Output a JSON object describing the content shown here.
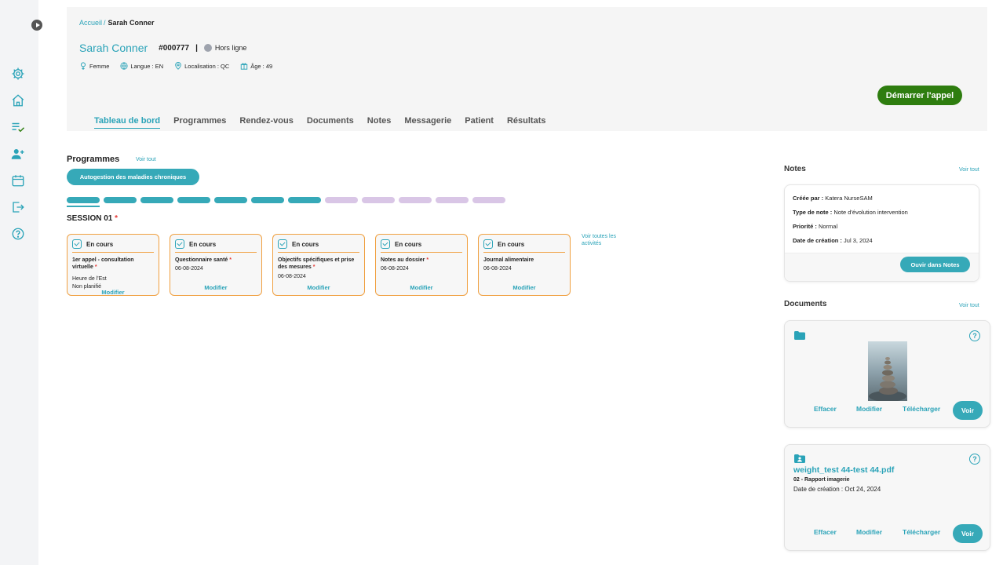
{
  "sidebar": {
    "items": [
      {
        "icon": "gear-icon"
      },
      {
        "icon": "home-icon"
      },
      {
        "icon": "checklist-icon"
      },
      {
        "icon": "add-user-icon"
      },
      {
        "icon": "calendar-icon"
      },
      {
        "icon": "logout-icon"
      },
      {
        "icon": "help-icon"
      }
    ],
    "accent": "#2aa3b8"
  },
  "header": {
    "breadcrumb": {
      "home": "Accueil",
      "separator": "/",
      "current": "Sarah Conner"
    },
    "patient": {
      "name": "Sarah Conner",
      "id": "#000777",
      "divider": "|",
      "status": "Hors ligne"
    },
    "meta": {
      "gender": "Femme",
      "language": "Langue : EN",
      "location": "Localisation : QC",
      "age": "Âge : 49"
    },
    "call_button": "Démarrer l'appel",
    "tabs": [
      "Tableau de bord",
      "Programmes",
      "Rendez-vous",
      "Documents",
      "Notes",
      "Messagerie",
      "Patient",
      "Résultats"
    ]
  },
  "programmes": {
    "title": "Programmes",
    "see_all": "Voir tout",
    "pill": "Autogestion des maladies chroniques",
    "segments": {
      "done": 7,
      "total": 12
    },
    "session": {
      "label": "SESSION 01",
      "required": "*"
    },
    "cards": [
      {
        "status": "En cours",
        "title": "1er appel - consultation virtuelle",
        "required": "*",
        "lines": [
          "Heure de l'Est",
          "Non planifié"
        ],
        "action": "Modifier"
      },
      {
        "status": "En cours",
        "title": "Questionnaire santé",
        "required": "*",
        "lines": [
          "06-08-2024"
        ],
        "action": "Modifier"
      },
      {
        "status": "En cours",
        "title": "Objectifs spécifiques et prise des mesures",
        "required": "*",
        "lines": [
          "06-08-2024"
        ],
        "action": "Modifier"
      },
      {
        "status": "En cours",
        "title": "Notes au dossier",
        "required": "*",
        "lines": [
          "06-08-2024"
        ],
        "action": "Modifier"
      },
      {
        "status": "En cours",
        "title": "Journal alimentaire",
        "required": "",
        "lines": [
          "06-08-2024"
        ],
        "action": "Modifier"
      }
    ],
    "all_activities": "Voir toutes les activités"
  },
  "notes": {
    "title": "Notes",
    "see_all": "Voir tout",
    "card": {
      "created_by_label": "Créée par :",
      "created_by": "Katera NurseSAM",
      "type_label": "Type de note :",
      "type": "Note d'évolution intervention",
      "priority_label": "Priorité :",
      "priority": "Normal",
      "date_label": "Date de création :",
      "date": "Jul 3, 2024",
      "open_button": "Ouvir dans Notes"
    }
  },
  "documents": {
    "title": "Documents",
    "see_all": "Voir tout",
    "cards": [
      {
        "icon": "folder-icon",
        "help": "?",
        "actions": [
          "Effacer",
          "Modifier",
          "Télécharger",
          "Voir"
        ]
      },
      {
        "icon": "folder-user-icon",
        "help": "?",
        "file_title": "weight_test 44-test 44.pdf",
        "file_type": "02 - Rapport imagerie",
        "file_date": "Date de création : Oct 24, 2024",
        "actions": [
          "Effacer",
          "Modifier",
          "Télécharger",
          "Voir"
        ]
      }
    ]
  }
}
